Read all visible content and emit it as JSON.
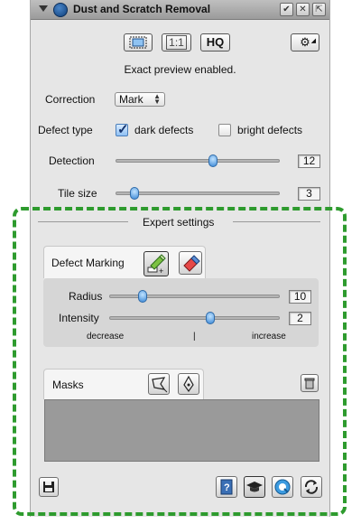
{
  "window": {
    "title": "Dust and Scratch Removal"
  },
  "toolbar": {
    "one_to_one_label": "1:1",
    "hq_label": "HQ"
  },
  "preview_status": "Exact preview enabled.",
  "correction": {
    "label": "Correction",
    "value": "Mark"
  },
  "defect_type": {
    "label": "Defect type",
    "dark": {
      "label": "dark defects",
      "checked": true
    },
    "bright": {
      "label": "bright defects",
      "checked": false
    }
  },
  "detection": {
    "label": "Detection",
    "value": "12",
    "level": 0.5
  },
  "tile_size": {
    "label": "Tile size",
    "value": "3",
    "level": 0.1
  },
  "expert": {
    "title": "Expert settings",
    "defect_marking": {
      "label": "Defect Marking",
      "radius": {
        "label": "Radius",
        "value": "10",
        "level": 0.2
      },
      "intensity": {
        "label": "Intensity",
        "value": "2",
        "level": 0.6
      },
      "decrease_label": "decrease",
      "increase_label": "increase",
      "separator": "|"
    },
    "masks": {
      "label": "Masks"
    }
  },
  "colors": {
    "highlight": "#2e9b2e",
    "slider_knob": "#3c88d6",
    "panel_bg": "#e6e6e6"
  }
}
